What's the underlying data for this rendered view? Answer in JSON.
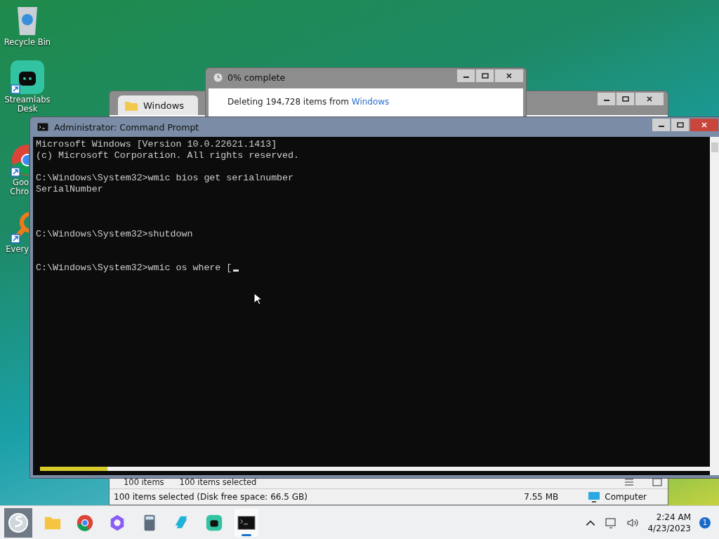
{
  "desktop_icons": [
    {
      "kind": "recycle",
      "label": "Recycle Bin",
      "shortcut": false
    },
    {
      "kind": "streamlabs",
      "label": "Streamlabs Desk",
      "shortcut": true
    },
    {
      "kind": "chrome",
      "label": "Goo Chro",
      "shortcut": true
    },
    {
      "kind": "search",
      "label": "Every",
      "shortcut": true
    }
  ],
  "explorer": {
    "tab": "Windows",
    "status_items": "100 items",
    "status_selected": "100 items selected",
    "details": "100 items selected (Disk free space: 66.5 GB)",
    "size": "7.55 MB",
    "location": "Computer"
  },
  "progress_dialog": {
    "title": "0% complete",
    "message": "Deleting 194,728 items from ",
    "link": "Windows"
  },
  "cmd": {
    "title": "Administrator: Command Prompt",
    "blocks": [
      [
        "Microsoft Windows [Version 10.0.22621.1413]",
        "(c) Microsoft Corporation. All rights reserved."
      ],
      [
        "C:\\Windows\\System32>wmic bios get serialnumber",
        "SerialNumber"
      ],
      [
        "C:\\Windows\\System32>shutdown"
      ],
      [
        "C:\\Windows\\System32>wmic os where ["
      ]
    ]
  },
  "taskbar": {
    "apps": [
      {
        "kind": "folder",
        "active": false
      },
      {
        "kind": "chrome",
        "active": false
      },
      {
        "kind": "copilot",
        "active": false
      },
      {
        "kind": "calculator",
        "active": false
      },
      {
        "kind": "app",
        "active": false
      },
      {
        "kind": "streamlabs",
        "active": false
      },
      {
        "kind": "terminal",
        "active": true
      }
    ],
    "time": "2:24 AM",
    "date": "4/23/2023",
    "notifications": "1"
  }
}
